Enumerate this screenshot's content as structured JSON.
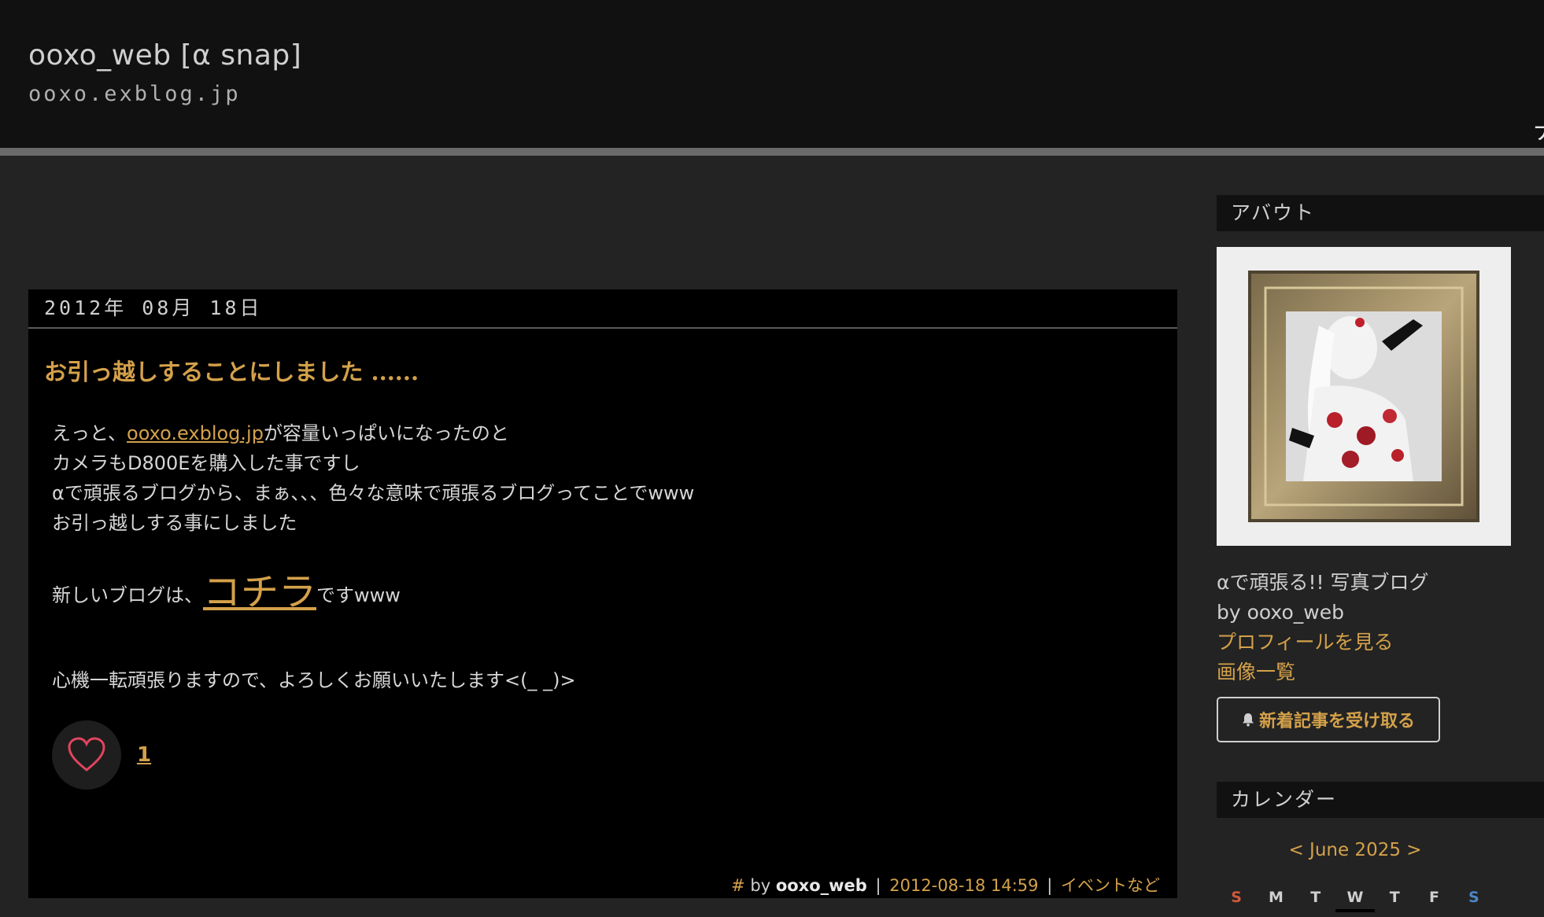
{
  "header": {
    "title": "ooxo_web [α snap]",
    "url": "ooxo.exblog.jp",
    "edge_glyph": "ナ"
  },
  "post": {
    "date": "2012年 08月 18日",
    "title": "お引っ越しすることにしました ......",
    "body": {
      "line1_prefix": "えっと、",
      "line1_link": "ooxo.exblog.jp",
      "line1_suffix": "が容量いっぱいになったのと",
      "line2": "カメラもD800Eを購入した事ですし",
      "line3": "αで頑張るブログから、まぁ、、、色々な意味で頑張るブログってことでwww",
      "line4": "お引っ越しする事にしました",
      "new_blog_prefix": "新しいブログは、",
      "new_blog_link": "コチラ",
      "new_blog_suffix": "ですwww",
      "closing": "心機一転頑張りますので、よろしくお願いいたします<(_ _)>"
    },
    "like_count": "1",
    "footer": {
      "hash": "#",
      "by": "by",
      "author": "ooxo_web",
      "separator": "|",
      "datetime": "2012-08-18 14:59",
      "category": "イベントなど"
    }
  },
  "sidebar": {
    "about": {
      "heading": "アバウト",
      "description": "αで頑張る!! 写真ブログ",
      "byline": "by ooxo_web",
      "profile_link": "プロフィールを見る",
      "images_link": "画像一覧",
      "subscribe_label": "新着記事を受け取る"
    },
    "calendar": {
      "heading": "カレンダー",
      "prev": "<",
      "month": "June 2025",
      "next": ">",
      "weekdays": [
        "S",
        "M",
        "T",
        "W",
        "T",
        "F",
        "S"
      ]
    }
  },
  "colors": {
    "accent": "#d4a14a",
    "background": "#232323",
    "header": "#111111",
    "post_background": "#000000"
  }
}
